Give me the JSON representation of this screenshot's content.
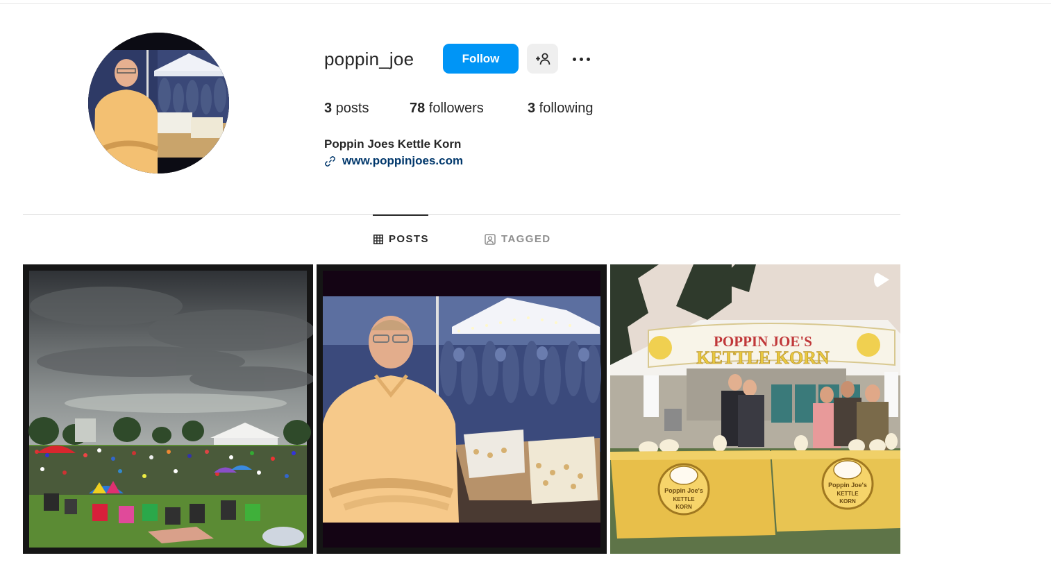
{
  "profile": {
    "username": "poppin_joe",
    "full_name": "Poppin Joes Kettle Korn",
    "website": "www.poppinjoes.com"
  },
  "actions": {
    "follow_label": "Follow",
    "suggest_icon": "person-add-icon",
    "more_icon": "more-options-icon"
  },
  "stats": [
    {
      "count": "3",
      "label": " posts"
    },
    {
      "count": "78",
      "label": " followers"
    },
    {
      "count": "3",
      "label": " following"
    }
  ],
  "tabs": [
    {
      "label": "POSTS",
      "icon": "grid-icon",
      "active": true
    },
    {
      "label": "TAGGED",
      "icon": "tagged-icon",
      "active": false
    }
  ],
  "posts": [
    {
      "scene": "outdoor concert crowd on lawn under cloudy sky"
    },
    {
      "scene": "man in yellow shirt at popcorn stand at night"
    },
    {
      "scene": "kettle corn tent with yellow tables",
      "type_icon": "reel-icon"
    }
  ],
  "post3_banner": {
    "line1": "POPPIN JOE'S",
    "line2": "KETTLE KORN"
  },
  "post3_table_logo": {
    "line1": "Poppin Joe's",
    "line2": "KETTLE",
    "line3": "KORN"
  },
  "colors": {
    "follow_blue": "#0095f6",
    "link_blue": "#00376b",
    "text": "#262626",
    "muted": "#8e8e8e"
  }
}
